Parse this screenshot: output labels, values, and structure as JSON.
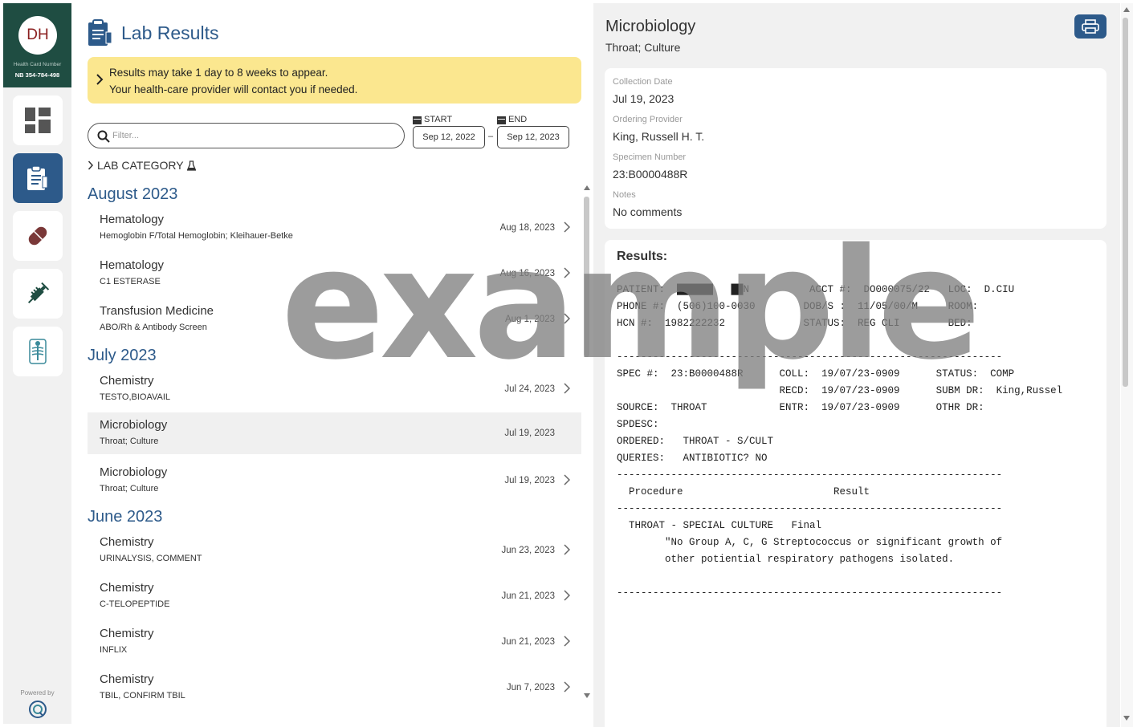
{
  "profile": {
    "initials": "DH",
    "hc_label": "Health Card Number",
    "hc_number": "NB 354-784-498"
  },
  "nav": [
    {
      "icon": "dashboard-icon",
      "active": false
    },
    {
      "icon": "clipboard-icon",
      "active": true
    },
    {
      "icon": "pill-icon",
      "active": false
    },
    {
      "icon": "syringe-icon",
      "active": false
    },
    {
      "icon": "xray-icon",
      "active": false
    }
  ],
  "footer": {
    "powered_by": "Powered by"
  },
  "page": {
    "title": "Lab Results"
  },
  "banner": {
    "line1": "Results may take 1 day to 8 weeks to appear.",
    "line2": "Your health-care provider will contact you if needed."
  },
  "filter": {
    "placeholder": "Filter..."
  },
  "dates": {
    "start_label": "START",
    "start_value": "Sep 12, 2022",
    "separator": "–",
    "end_label": "END",
    "end_value": "Sep 12, 2023"
  },
  "category": {
    "label": "LAB CATEGORY"
  },
  "groups": [
    {
      "month": "August 2023",
      "items": [
        {
          "title": "Hematology",
          "sub": "Hemoglobin F/Total Hemoglobin; Kleihauer-Betke",
          "date": "Aug 18, 2023"
        },
        {
          "title": "Hematology",
          "sub": "C1 ESTERASE",
          "date": "Aug 16, 2023"
        },
        {
          "title": "Transfusion Medicine",
          "sub": "ABO/Rh & Antibody Screen",
          "date": "Aug 1, 2023"
        }
      ]
    },
    {
      "month": "July 2023",
      "items": [
        {
          "title": "Chemistry",
          "sub": "TESTO,BIOAVAIL",
          "date": "Jul 24, 2023"
        },
        {
          "title": "Microbiology",
          "sub": "Throat; Culture",
          "date": "Jul 19, 2023",
          "selected": true
        },
        {
          "title": "Microbiology",
          "sub": "Throat; Culture",
          "date": "Jul 19, 2023"
        }
      ]
    },
    {
      "month": "June 2023",
      "items": [
        {
          "title": "Chemistry",
          "sub": "URINALYSIS, COMMENT",
          "date": "Jun 23, 2023"
        },
        {
          "title": "Chemistry",
          "sub": "C-TELOPEPTIDE",
          "date": "Jun 21, 2023"
        },
        {
          "title": "Chemistry",
          "sub": "INFLIX",
          "date": "Jun 21, 2023"
        },
        {
          "title": "Chemistry",
          "sub": "TBIL, CONFIRM TBIL",
          "date": "Jun 7, 2023"
        }
      ]
    }
  ],
  "detail": {
    "title": "Microbiology",
    "subtitle": "Throat; Culture",
    "fields": [
      {
        "label": "Collection Date",
        "value": "Jul 19, 2023"
      },
      {
        "label": "Ordering Provider",
        "value": "King, Russell H. T."
      },
      {
        "label": "Specimen Number",
        "value": "23:B0000488R"
      },
      {
        "label": "Notes",
        "value": "No comments"
      }
    ],
    "results_label": "Results:",
    "report": "PATIENT:  ██████   ██N          ACCT #:  DO000075/22   LOC:  D.CIU\nPHONE #:  (506)100-0030        DOB/S :  11/05/00/M     ROOM:\nHCN #:  1982222232             STATUS:  REG CLI        BED:\n\n----------------------------------------------------------------\nSPEC #:  23:B0000488R      COLL:  19/07/23-0909      STATUS:  COMP\n                           RECD:  19/07/23-0909      SUBM DR:  King,Russel\nSOURCE:  THROAT            ENTR:  19/07/23-0909      OTHR DR:\nSPDESC:\nORDERED:   THROAT - S/CULT\nQUERIES:   ANTIBIOTIC? NO\n----------------------------------------------------------------\n  Procedure                         Result\n----------------------------------------------------------------\n  THROAT - SPECIAL CULTURE   Final\n        \"No Group A, C, G Streptococcus or significant growth of\n        other potiential respiratory pathogens isolated.\n\n----------------------------------------------------------------"
  },
  "watermark": "example"
}
